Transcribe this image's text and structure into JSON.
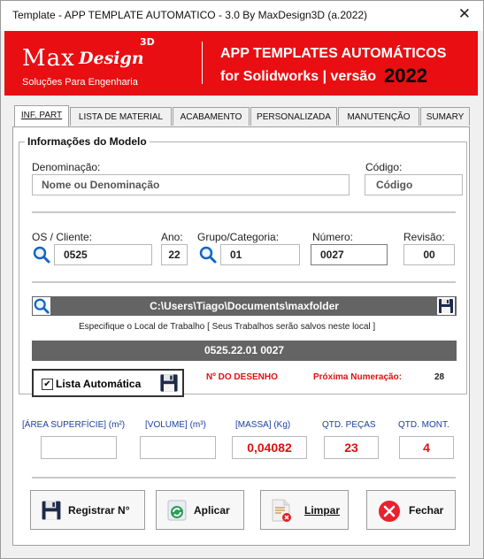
{
  "window": {
    "title": "Template - APP TEMPLATE AUTOMATICO - 3.0 By MaxDesign3D (a.2022)",
    "close": "✕"
  },
  "banner": {
    "logo_max": "Max",
    "logo_design": "Design",
    "logo_3d": "3D",
    "logo_sub": "Soluções Para Engenharia",
    "title1": "APP TEMPLATES AUTOMÁTICOS",
    "title2": "for Solidworks | versão",
    "year": "2022",
    "color": "#e90e12"
  },
  "tabs": [
    "INF. PART",
    "LISTA DE MATERIAL",
    "ACABAMENTO",
    "PERSONALIZADA",
    "MANUTENÇÃO",
    "SUMARY"
  ],
  "group": {
    "title": "Informações do Modelo"
  },
  "form": {
    "denominacao_label": "Denominação:",
    "denominacao_value": "Nome ou Denominação",
    "codigo_label": "Código:",
    "codigo_value": "Código",
    "os_label": "OS / Cliente:",
    "os_value": "0525",
    "ano_label": "Ano:",
    "ano_value": "22",
    "grupo_label": "Grupo/Categoria:",
    "grupo_value": "01",
    "numero_label": "Número:",
    "numero_value": "0027",
    "revisao_label": "Revisão:",
    "revisao_value": "00"
  },
  "folder": {
    "path": "C:\\Users\\Tiago\\Documents\\maxfolder",
    "hint": "Especifique o Local de Trabalho [ Seus Trabalhos serão salvos neste local ]"
  },
  "drawing_number": "0525.22.01 0027",
  "lista": {
    "label": "Lista Automática",
    "checked": true
  },
  "numeracao": {
    "nr_label": "Nº DO DESENHO",
    "proxima_label": "Próxima Numeração:",
    "proxima_value": "28"
  },
  "metrics": {
    "area_label": "[ÁREA SUPERFÍCIE] (m²)",
    "area_value": "",
    "volume_label": "[VOLUME] (m³)",
    "volume_value": "",
    "massa_label": "[MASSA] (Kg)",
    "massa_value": "0,04082",
    "pecas_label": "QTD. PEÇAS",
    "pecas_value": "23",
    "mont_label": "QTD.  MONT.",
    "mont_value": "4"
  },
  "buttons": {
    "registrar": "Registrar N°",
    "aplicar": "Aplicar",
    "limpar": "Limpar",
    "fechar": "Fechar"
  }
}
